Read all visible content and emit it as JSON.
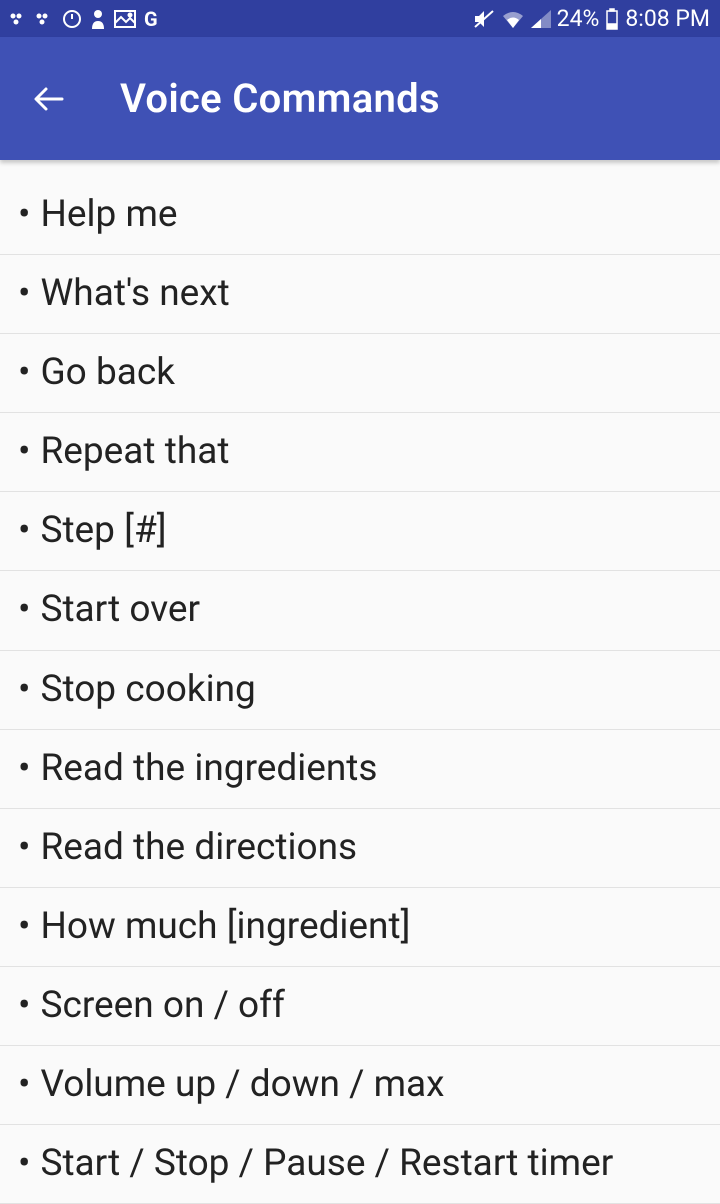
{
  "status": {
    "battery": "24%",
    "time": "8:08 PM"
  },
  "appbar": {
    "title": "Voice Commands"
  },
  "commands": [
    "Help me",
    "What's next",
    "Go back",
    "Repeat that",
    "Step [#]",
    "Start over",
    "Stop cooking",
    "Read the ingredients",
    "Read the directions",
    "How much [ingredient]",
    "Screen on / off",
    "Volume up / down / max",
    "Start / Stop / Pause / Restart timer"
  ]
}
